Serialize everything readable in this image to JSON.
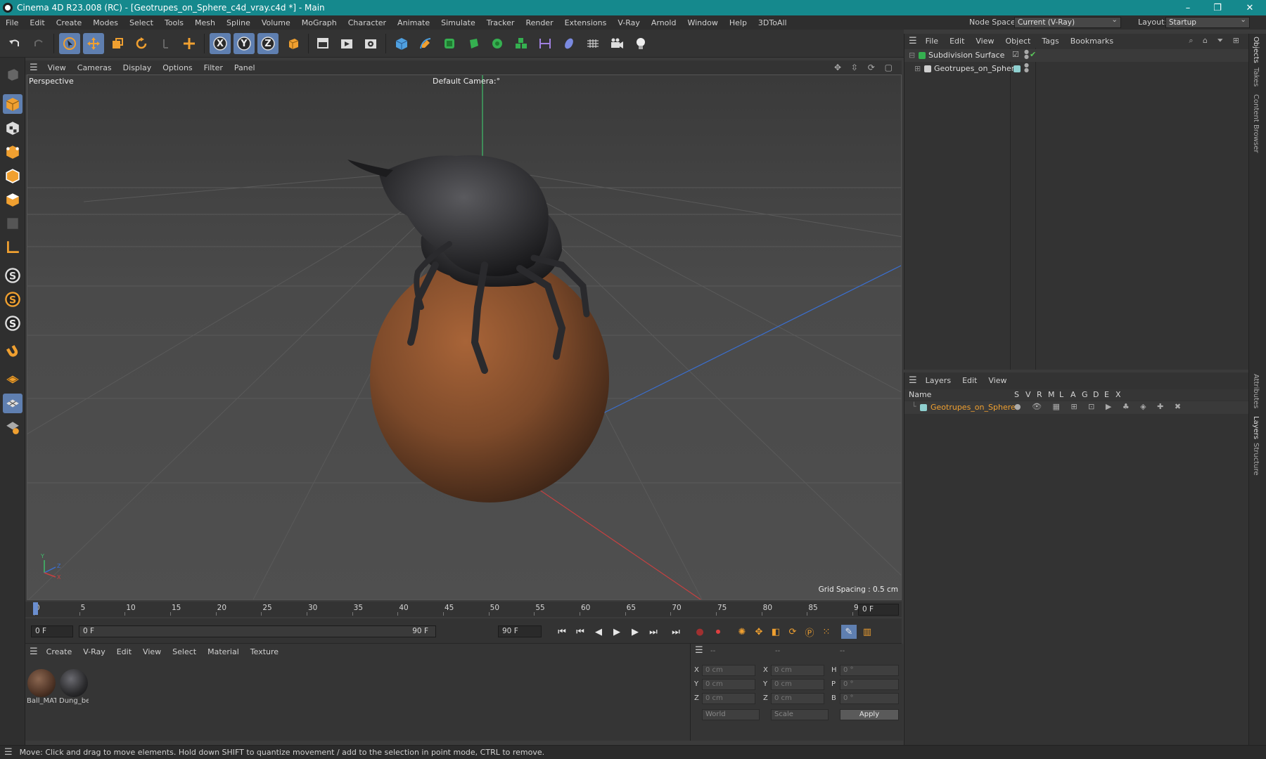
{
  "window": {
    "title": "Cinema 4D R23.008 (RC) - [Geotrupes_on_Sphere_c4d_vray.c4d *] - Main",
    "minimize": "–",
    "maximize": "❐",
    "close": "✕"
  },
  "menubar": {
    "items": [
      "File",
      "Edit",
      "Create",
      "Modes",
      "Select",
      "Tools",
      "Mesh",
      "Spline",
      "Volume",
      "MoGraph",
      "Character",
      "Animate",
      "Simulate",
      "Tracker",
      "Render",
      "Extensions",
      "V-Ray",
      "Arnold",
      "Window",
      "Help",
      "3DToAll"
    ],
    "node_space_label": "Node Space:",
    "node_space_value": "Current (V-Ray)",
    "layout_label": "Layout:",
    "layout_value": "Startup"
  },
  "toolbar": {
    "axis_x": "X",
    "axis_y": "Y",
    "axis_z": "Z"
  },
  "viewport": {
    "menu": [
      "View",
      "Cameras",
      "Display",
      "Options",
      "Filter",
      "Panel"
    ],
    "name": "Perspective",
    "camera": "Default Camera",
    "camera_suffix": ":°",
    "grid_spacing": "Grid Spacing : 0.5 cm",
    "axis_y": "Y",
    "axis_z": "Z",
    "axis_x": "X"
  },
  "timeline": {
    "ticks": [
      "0",
      "5",
      "10",
      "15",
      "20",
      "25",
      "30",
      "35",
      "40",
      "45",
      "50",
      "55",
      "60",
      "65",
      "70",
      "75",
      "80",
      "85",
      "90"
    ],
    "current_frame": "0 F",
    "start_field": "0 F",
    "range_start": "0 F",
    "range_end": "90 F",
    "end_field": "90 F"
  },
  "materials": {
    "menu": [
      "Create",
      "V-Ray",
      "Edit",
      "View",
      "Select",
      "Material",
      "Texture"
    ],
    "items": [
      {
        "name": "Ball_MAT",
        "color": "#6a4a35"
      },
      {
        "name": "Dung_be",
        "color": "#2a2a2c"
      }
    ]
  },
  "coordinates": {
    "header": [
      "--",
      "--",
      "--"
    ],
    "rows": [
      {
        "a": "X",
        "av": "0 cm",
        "b": "X",
        "bv": "0 cm",
        "c": "H",
        "cv": "0 °"
      },
      {
        "a": "Y",
        "av": "0 cm",
        "b": "Y",
        "bv": "0 cm",
        "c": "P",
        "cv": "0 °"
      },
      {
        "a": "Z",
        "av": "0 cm",
        "b": "Z",
        "bv": "0 cm",
        "c": "B",
        "cv": "0 °"
      }
    ],
    "space": "World",
    "mode": "Scale",
    "apply": "Apply"
  },
  "objects": {
    "menu": [
      "File",
      "Edit",
      "View",
      "Object",
      "Tags",
      "Bookmarks"
    ],
    "items": [
      {
        "name": "Subdivision Surface",
        "color": "#5ab85a"
      },
      {
        "name": "Geotrupes_on_Sphere",
        "color": "#8cc"
      }
    ]
  },
  "layers": {
    "menu": [
      "Layers",
      "Edit",
      "View"
    ],
    "columns": [
      "Name",
      "S",
      "V",
      "R",
      "M",
      "L",
      "A",
      "G",
      "D",
      "E",
      "X"
    ],
    "items": [
      {
        "name": "Geotrupes_on_Sphere",
        "color": "#8fd0d0"
      }
    ]
  },
  "sidetabs": [
    "Objects",
    "Takes",
    "Content Browser",
    "Attributes",
    "Layers",
    "Structure"
  ],
  "status": "Move: Click and drag to move elements. Hold down SHIFT to quantize movement / add to the selection in point mode, CTRL to remove."
}
